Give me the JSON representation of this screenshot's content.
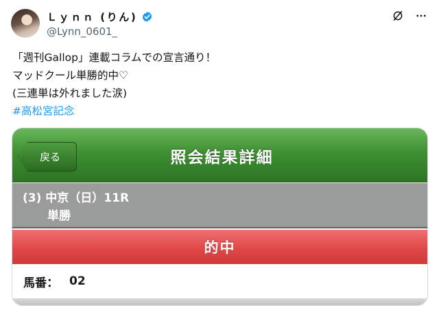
{
  "author": {
    "display_name": "Ｌｙｎｎ (りん)",
    "handle": "@Lynn_0601_"
  },
  "tweet": {
    "lines": "「週刊Gallop」連載コラムでの宣言通り！\nマッドクール単勝的中♡\n(三連単は外れました涙)",
    "hashtag": "#高松宮記念"
  },
  "media": {
    "back_label": "戻る",
    "title": "照会結果詳細",
    "race_line1": "(3)  中京（日）11R",
    "race_line2": "単勝",
    "result": "的中",
    "horse_label": "馬番：",
    "horse_number": "02"
  },
  "icons": {
    "verified": "verified-badge-icon",
    "grok": "grok-icon",
    "more": "more-icon"
  },
  "colors": {
    "verified": "#1d9bf0",
    "hashtag": "#1d9bf0",
    "header_green": "#3f8f33",
    "hit_red": "#e04848",
    "race_gray": "#9a9c9b"
  }
}
